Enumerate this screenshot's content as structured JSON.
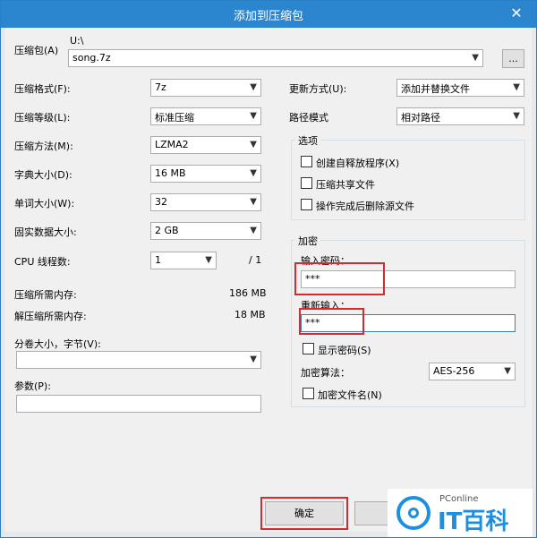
{
  "window": {
    "title": "添加到压缩包",
    "close_glyph": "✕"
  },
  "archive": {
    "label": "压缩包(A)",
    "path": "U:\\",
    "filename": "song.7z",
    "browse_label": "..."
  },
  "left": {
    "format": {
      "label": "压缩格式(F):",
      "value": "7z"
    },
    "level": {
      "label": "压缩等级(L):",
      "value": "标准压缩"
    },
    "method": {
      "label": "压缩方法(M):",
      "value": "LZMA2"
    },
    "dict": {
      "label": "字典大小(D):",
      "value": "16 MB"
    },
    "word": {
      "label": "单词大小(W):",
      "value": "32"
    },
    "solid": {
      "label": "固实数据大小:",
      "value": "2 GB"
    },
    "cpu": {
      "label": "CPU 线程数:",
      "value": "1",
      "max": "/ 1"
    },
    "mem_compress": {
      "label": "压缩所需内存:",
      "value": "186 MB"
    },
    "mem_decompress": {
      "label": "解压缩所需内存:",
      "value": "18 MB"
    },
    "volume": {
      "label": "分卷大小，字节(V):",
      "value": ""
    },
    "params": {
      "label": "参数(P):",
      "value": ""
    }
  },
  "right": {
    "update": {
      "label": "更新方式(U):",
      "value": "添加并替换文件"
    },
    "pathmode": {
      "label": "路径模式",
      "value": "相对路径"
    },
    "options": {
      "title": "选项",
      "sfx": "创建自释放程序(X)",
      "shared": "压缩共享文件",
      "delete": "操作完成后删除源文件"
    },
    "encryption": {
      "title": "加密",
      "enter_label": "输入密码：",
      "enter_value": "***",
      "reenter_label": "重新输入：",
      "reenter_value": "***",
      "show_password": "显示密码(S)",
      "method_label": "加密算法：",
      "method_value": "AES-256",
      "encrypt_names": "加密文件名(N)"
    }
  },
  "buttons": {
    "ok": "确定"
  },
  "watermark": {
    "small": "PConline",
    "big": "IT百科"
  }
}
